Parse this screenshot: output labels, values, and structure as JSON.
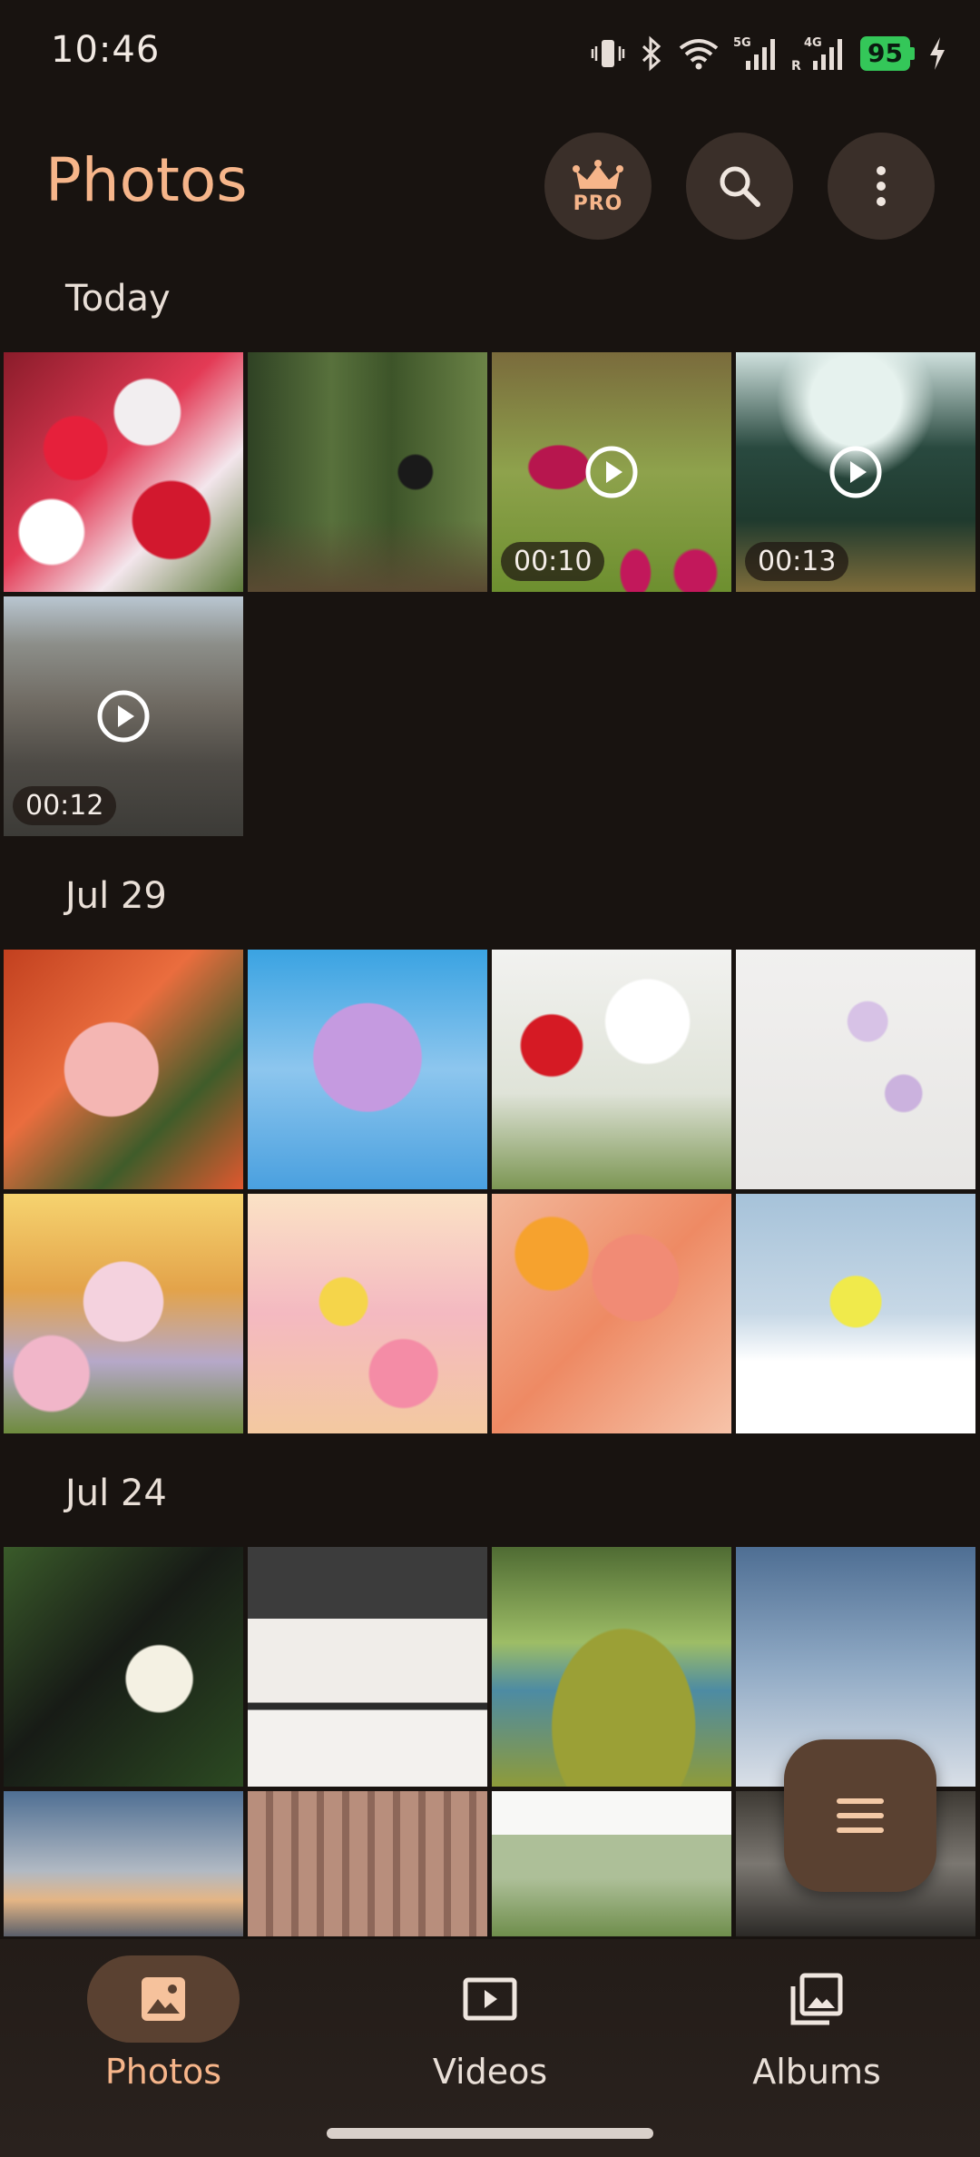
{
  "status_bar": {
    "time": "10:46",
    "battery": "95",
    "network_1": "5G",
    "network_2": "4G",
    "roaming": "R"
  },
  "header": {
    "title": "Photos",
    "pro_label": "PRO"
  },
  "sections": [
    {
      "label": "Today",
      "items": [
        {
          "type": "photo",
          "duration": ""
        },
        {
          "type": "photo",
          "duration": ""
        },
        {
          "type": "video",
          "duration": "00:10"
        },
        {
          "type": "video",
          "duration": "00:13"
        },
        {
          "type": "video",
          "duration": "00:12"
        }
      ]
    },
    {
      "label": "Jul 29"
    },
    {
      "label": "Jul 24"
    }
  ],
  "bottom_nav": [
    {
      "label": "Photos",
      "icon": "image-icon",
      "active": true
    },
    {
      "label": "Videos",
      "icon": "video-icon",
      "active": false
    },
    {
      "label": "Albums",
      "icon": "albums-icon",
      "active": false
    }
  ],
  "colors": {
    "accent": "#f6b58a",
    "surface": "#181310",
    "indicator": "#5a4131"
  }
}
